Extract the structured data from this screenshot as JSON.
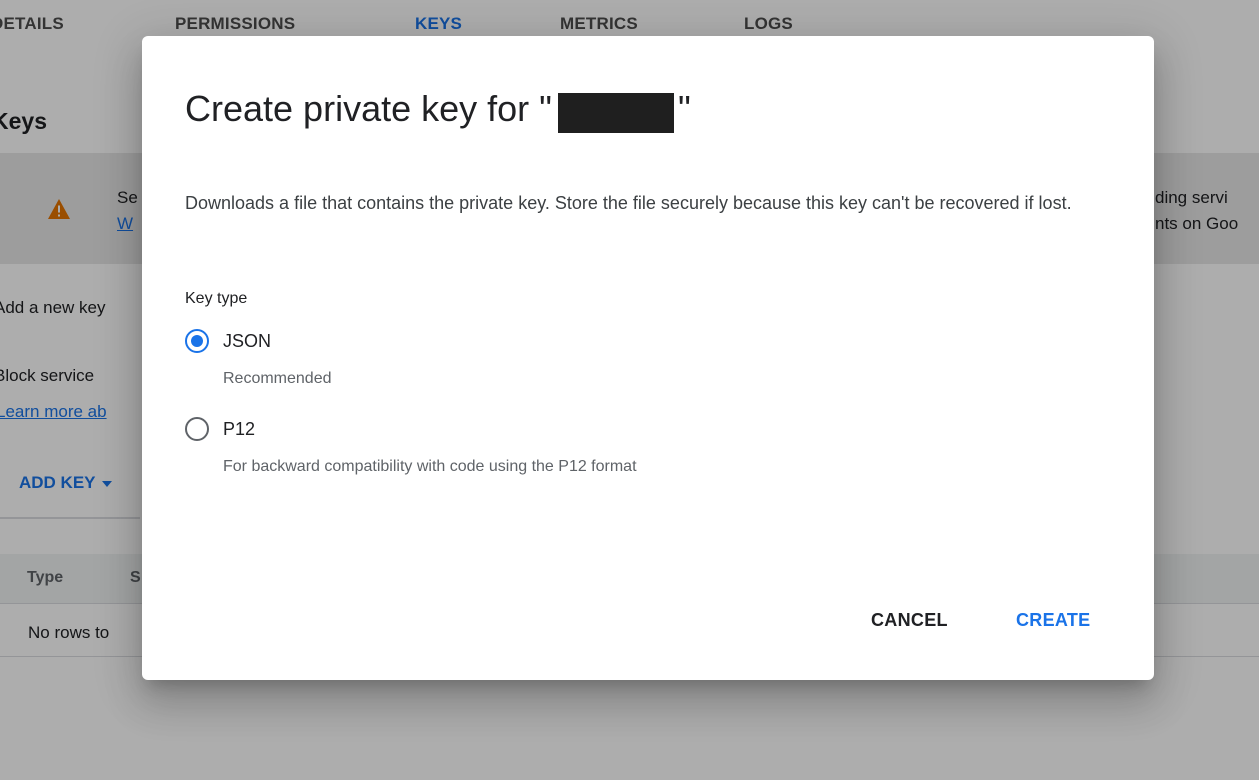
{
  "tabs": [
    {
      "label": "DETAILS",
      "active": false
    },
    {
      "label": "PERMISSIONS",
      "active": false
    },
    {
      "label": "KEYS",
      "active": true
    },
    {
      "label": "METRICS",
      "active": false
    },
    {
      "label": "LOGS",
      "active": false
    }
  ],
  "background": {
    "title": "Keys",
    "banner": {
      "icon": "warning-icon",
      "left_line1": "Se",
      "left_link": "W",
      "right_line1": "ding servi",
      "right_line2": "nts on Goo"
    },
    "add_key_text": "Add a new key",
    "block_text": "Block service",
    "learn_more_link": "Learn more ab",
    "add_key_button": "ADD KEY",
    "table": {
      "columns": [
        "Type",
        "S"
      ],
      "empty_text": "No rows to"
    }
  },
  "dialog": {
    "title_prefix": "Create private key for \"",
    "title_suffix": "\"",
    "description": "Downloads a file that contains the private key. Store the file securely because this key can't be recovered if lost.",
    "key_type_label": "Key type",
    "options": [
      {
        "label": "JSON",
        "sublabel": "Recommended",
        "checked": true
      },
      {
        "label": "P12",
        "sublabel": "For backward compatibility with code using the P12 format",
        "checked": false
      }
    ],
    "cancel_label": "CANCEL",
    "create_label": "CREATE"
  },
  "colors": {
    "accent": "#1a73e8",
    "warning": "#e37400",
    "scrim": "rgba(0,0,0,0.32)"
  }
}
